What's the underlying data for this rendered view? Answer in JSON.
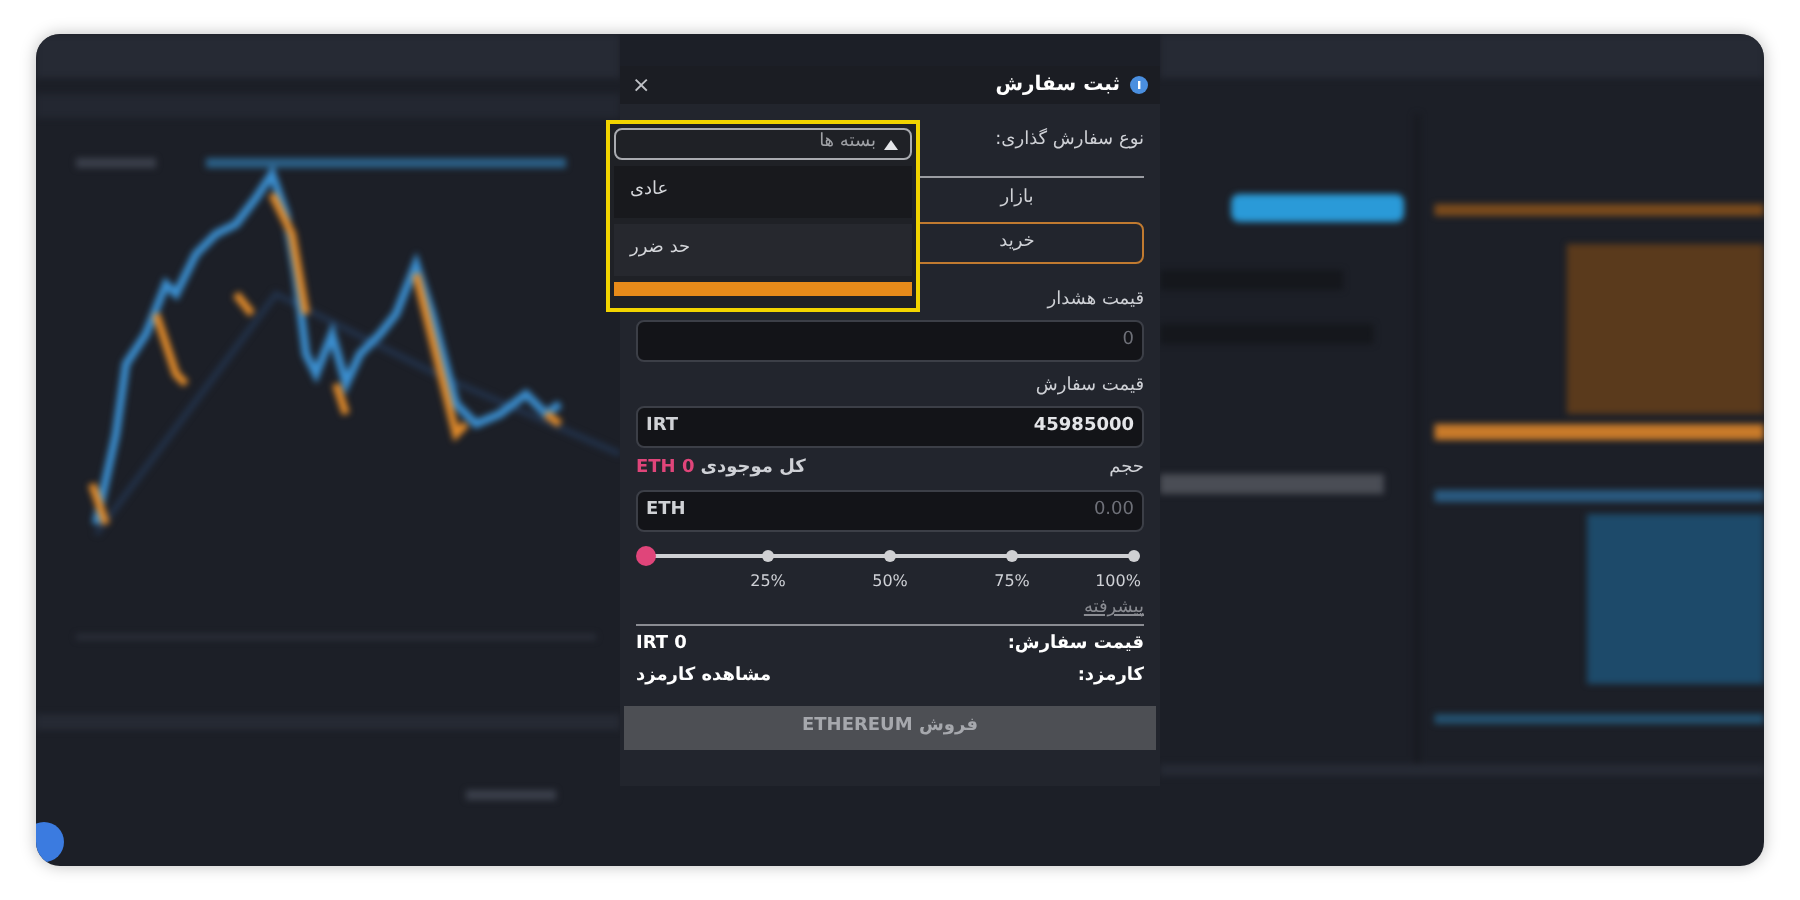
{
  "dialog": {
    "title": "ثبت سفارش",
    "close": "×"
  },
  "order_type": {
    "label": "نوع سفارش گذاری:",
    "dropdown": {
      "value": "بسته ها",
      "expanded": true,
      "options": [
        {
          "label": "عادی",
          "highlighted": false
        },
        {
          "label": "حد ضرر",
          "highlighted": false
        },
        {
          "kind": "cut",
          "highlighted": true
        }
      ]
    }
  },
  "tabs": [
    {
      "label": "بازار",
      "selected": false
    }
  ],
  "side_button": {
    "label": "خرید",
    "selected": true
  },
  "alert_price": {
    "label": "قیمت هشدار",
    "placeholder": "0"
  },
  "order_price": {
    "label": "قیمت سفارش",
    "unit": "IRT",
    "value": "45985000"
  },
  "volume": {
    "label": "حجم",
    "balance_label": "کل موجودی",
    "balance": "ETH 0",
    "unit": "ETH",
    "placeholder": "0.00"
  },
  "slider": {
    "level": 0,
    "ticks": [
      "100%",
      "75%",
      "50%",
      "25%"
    ]
  },
  "advanced_link": "پیشرفته",
  "summary": [
    {
      "label": "قیمت سفارش:",
      "value": "IRT 0"
    },
    {
      "label": "کارمزد:",
      "value": "مشاهده کارمزد"
    }
  ],
  "submit": {
    "label": "فروش ETHEREUM",
    "disabled": true
  }
}
